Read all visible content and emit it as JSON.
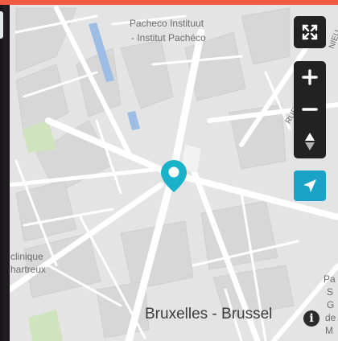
{
  "map": {
    "labels": {
      "pacheco_line1": "Pacheco Instituut",
      "pacheco_line2": "- Institut Pachéco",
      "clinique_line1": "clinique",
      "clinique_line2": "hartreux",
      "city": "Bruxelles - Brussel",
      "street_right": "NIEU",
      "street_diag": "RUE",
      "edge_p": "Pa",
      "edge_s": "S",
      "edge_g": "G",
      "edge_d": "de",
      "edge_m": "M"
    },
    "marker": {
      "icon": "map-pin-icon",
      "color": "#1ab2c8"
    },
    "colors": {
      "land": "#e5e5e5",
      "roads": "#ffffff",
      "park": "#c9e0ba",
      "water": "#8fb4e0",
      "accent": "#f25b43"
    }
  },
  "controls": {
    "fullscreen": "expand-icon",
    "zoom_in": "plus-icon",
    "zoom_out": "minus-icon",
    "compass": "compass-icon",
    "locate": "navigation-arrow-icon",
    "info": "i"
  }
}
